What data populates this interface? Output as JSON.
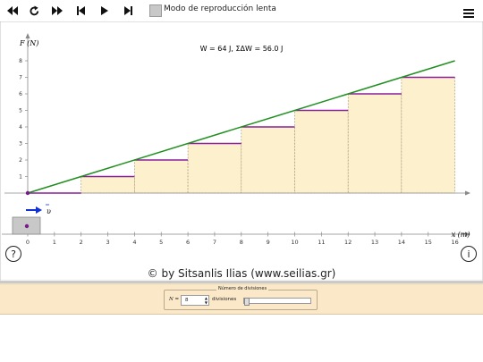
{
  "toolbar": {
    "buttons": [
      {
        "name": "rewind-icon"
      },
      {
        "name": "reload-icon"
      },
      {
        "name": "fast-forward-icon"
      },
      {
        "name": "step-back-icon"
      },
      {
        "name": "play-icon"
      },
      {
        "name": "step-forward-icon"
      }
    ],
    "slow_mode_label": "Modo de reproducción lenta",
    "menu_icon": "hamburger-menu-icon"
  },
  "graph": {
    "y_axis_label": "F (N)",
    "x_axis_label": "x (m)",
    "work_text": "W = 64 J,  ΣΔW = 56.0 J",
    "velocity_label": "υ",
    "y_ticks": [
      "1",
      "2",
      "3",
      "4",
      "5",
      "6",
      "7",
      "8"
    ],
    "x_ticks": [
      "0",
      "1",
      "2",
      "3",
      "4",
      "5",
      "6",
      "7",
      "8",
      "9",
      "10",
      "11",
      "12",
      "13",
      "14",
      "15",
      "16"
    ]
  },
  "chart_data": {
    "type": "line",
    "xlabel": "x (m)",
    "ylabel": "F (N)",
    "xlim": [
      0,
      16
    ],
    "ylim": [
      0,
      8
    ],
    "series": [
      {
        "x": [
          0,
          16
        ],
        "y": [
          0,
          8
        ]
      }
    ],
    "steps": {
      "x_start": [
        0,
        2,
        4,
        6,
        8,
        10,
        12,
        14
      ],
      "width": 2,
      "F": [
        0,
        1,
        2,
        3,
        4,
        5,
        6,
        7
      ]
    },
    "annotation": "W = 64 J,  ΣΔW = 56.0 J"
  },
  "colors": {
    "line": "#1f8f1f",
    "steps": "#8a1f9a",
    "fill": "#fdf0cd",
    "axis": "#888888",
    "arrow": "#1030d8",
    "dot": "#7a1a8a"
  },
  "help_icon_text": "?",
  "info_icon_text": "i",
  "credit": "© by Sitsanlis Ilias (www.seilias.gr)",
  "panel": {
    "legend": "Número de divisiones",
    "n_label": "N =",
    "n_value": "8",
    "unit": "divisiones"
  }
}
